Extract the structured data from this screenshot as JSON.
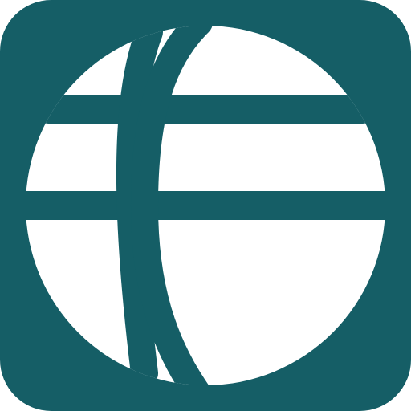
{
  "app_icon": {
    "icon": "globe-icon",
    "colors": {
      "tile_background": "#155e66",
      "globe_fill": "#ffffff",
      "grid_lines": "#155e66"
    }
  }
}
